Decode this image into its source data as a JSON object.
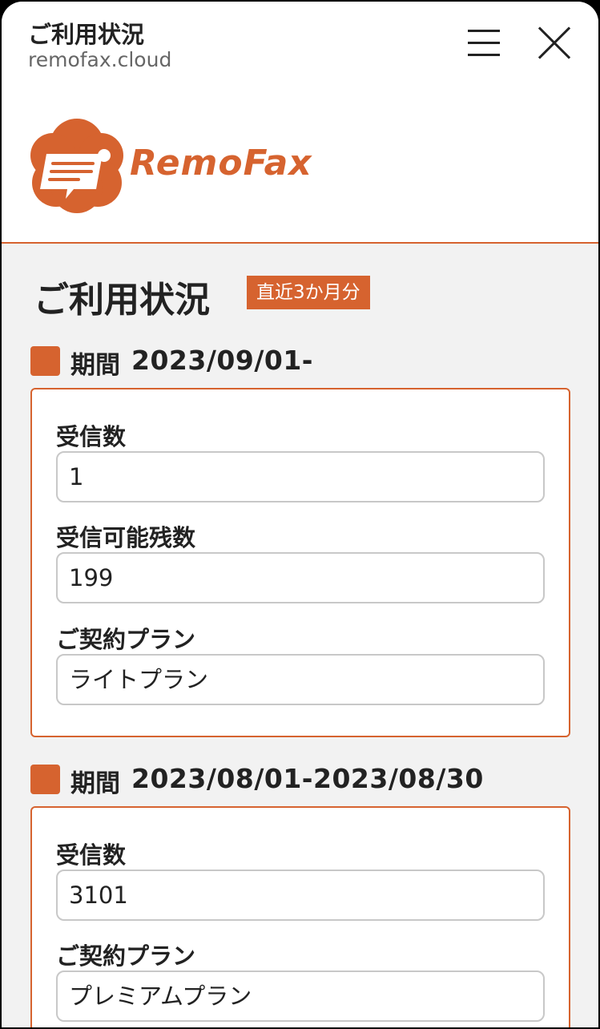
{
  "topbar": {
    "title": "ご利用状況",
    "url": "remofax.cloud",
    "menu_icon": "hamburger-menu-icon",
    "close_icon": "close-icon"
  },
  "brand": {
    "logo_text": "RemoFax",
    "accent_color": "#d6632f"
  },
  "page": {
    "title": "ご利用状況",
    "badge": "直近3か月分"
  },
  "periods": [
    {
      "label": "期間",
      "range": "2023/09/01-",
      "fields": [
        {
          "label": "受信数",
          "value": "1"
        },
        {
          "label": "受信可能残数",
          "value": "199"
        },
        {
          "label": "ご契約プラン",
          "value": "ライトプラン"
        }
      ]
    },
    {
      "label": "期間",
      "range": "2023/08/01-2023/08/30",
      "fields": [
        {
          "label": "受信数",
          "value": "3101"
        },
        {
          "label": "ご契約プラン",
          "value": "プレミアムプラン"
        }
      ]
    }
  ]
}
